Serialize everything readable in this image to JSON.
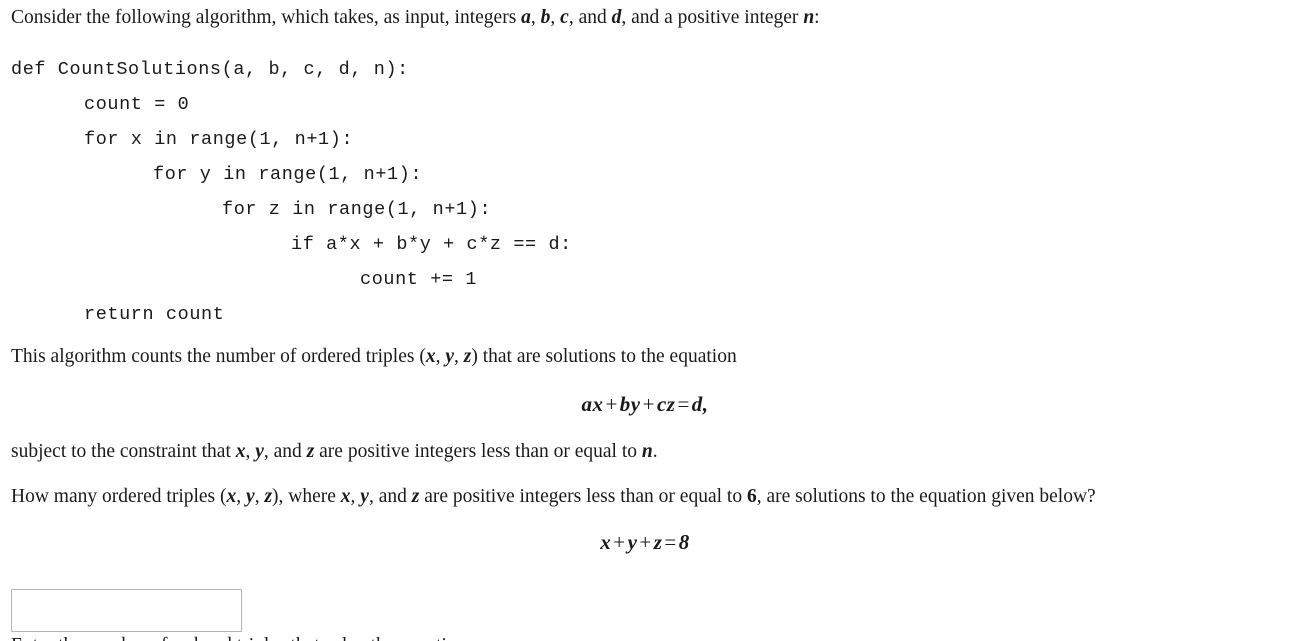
{
  "document": {
    "intro": {
      "before_vars": "Consider the following algorithm, which takes, as input, integers ",
      "var_a": "a",
      "sep1": ", ",
      "var_b": "b",
      "sep2": ", ",
      "var_c": "c",
      "sep3": ", and ",
      "var_d": "d",
      "after_vars": ", and a positive integer ",
      "var_n": "n",
      "end": ":"
    },
    "code": {
      "language": "python",
      "lines": [
        {
          "indent": 0,
          "text": "def CountSolutions(a, b, c, d, n):"
        },
        {
          "indent": 1,
          "text": "count = 0"
        },
        {
          "indent": 1,
          "text": "for x in range(1, n+1):"
        },
        {
          "indent": 2,
          "text": "for y in range(1, n+1):"
        },
        {
          "indent": 3,
          "text": "for z in range(1, n+1):"
        },
        {
          "indent": 4,
          "text": "if a*x + b*y + c*z == d:"
        },
        {
          "indent": 5,
          "text": "count += 1"
        },
        {
          "indent": 1,
          "text": "return count"
        }
      ]
    },
    "paragraph_triples": {
      "part1": "This algorithm counts the number of ordered triples ",
      "triple_open": "(",
      "triple_x": "x",
      "triple_c1": ", ",
      "triple_y": "y",
      "triple_c2": ", ",
      "triple_z": "z",
      "triple_close": ")",
      "part2": " that are solutions to the equation"
    },
    "equation_general": {
      "t1": "ax",
      "op1": "+",
      "t2": "by",
      "op2": "+",
      "t3": "cz",
      "eq": "=",
      "rhs": "d,"
    },
    "paragraph_constraint": {
      "part1": "subject to the constraint that ",
      "v1": "x",
      "c1": ", ",
      "v2": "y",
      "c2": ", and ",
      "v3": "z",
      "part2": " are positive integers less than or equal to ",
      "v4": "n",
      "part3": "."
    },
    "paragraph_question": {
      "part1": "How many ordered triples ",
      "triple_open": "(",
      "triple_x": "x",
      "triple_c1": ", ",
      "triple_y": "y",
      "triple_c2": ", ",
      "triple_z": "z",
      "triple_close": ")",
      "part2": ", where ",
      "v1": "x",
      "c1": ", ",
      "v2": "y",
      "c2": ", and ",
      "v3": "z",
      "part3": " are positive integers less than or equal to ",
      "bound": "6",
      "part4": ", are solutions to the equation given below?"
    },
    "equation_specific": {
      "t1": "x",
      "op1": "+",
      "t2": "y",
      "op2": "+",
      "t3": "z",
      "eq": "=",
      "rhs": "8"
    },
    "answer_input": {
      "value": "",
      "placeholder": ""
    },
    "clipped_bottom_text": "Enter the number of ordered triples that solve the equation."
  }
}
